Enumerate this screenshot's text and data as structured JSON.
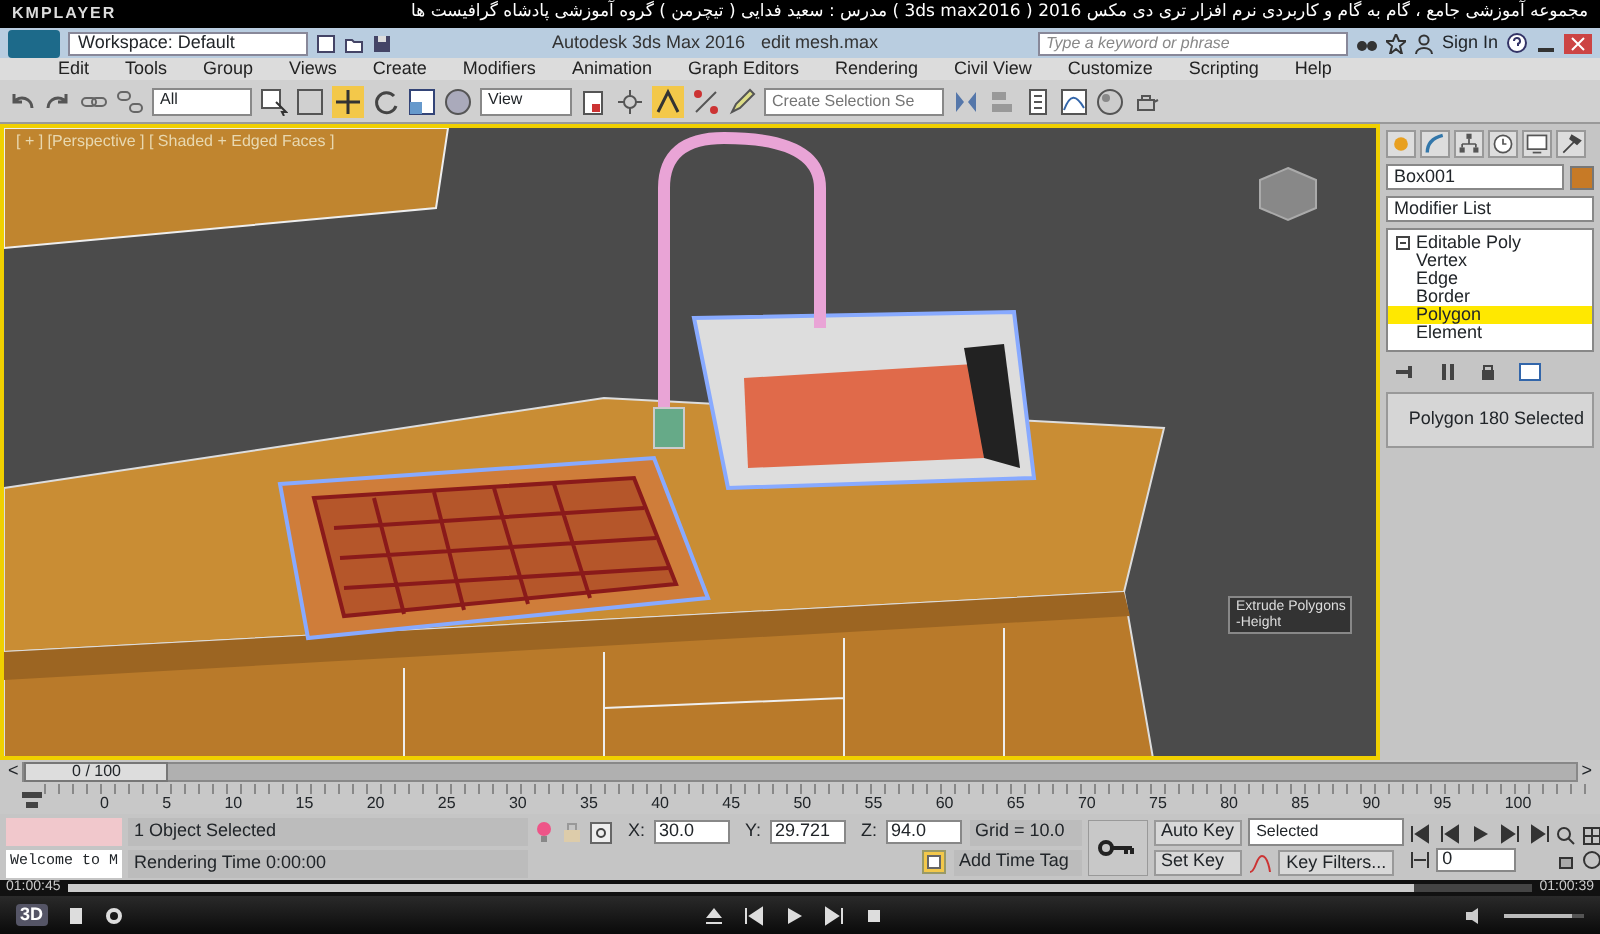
{
  "player": {
    "brand": "KMPLAYER",
    "title": "مجموعه آموزشی جامع ، گام به گام و کاربردی نرم افزار تری دی مکس 2016 ( 3ds max2016 ) مدرس : سعید فدایی ( تیچرمن ) گروه آموزشی پادشاه گرافیست ها"
  },
  "app": {
    "workspace": "Workspace: Default",
    "title": "Autodesk 3ds Max 2016",
    "file": "edit mesh.max",
    "search": {
      "placeholder": "Type a keyword or phrase"
    },
    "sign_in": "Sign In"
  },
  "menu": [
    "Edit",
    "Tools",
    "Group",
    "Views",
    "Create",
    "Modifiers",
    "Animation",
    "Graph Editors",
    "Rendering",
    "Civil View",
    "Customize",
    "Scripting",
    "Help"
  ],
  "toolbar": {
    "selection_filter": "All",
    "reference_coord": "View",
    "named_selection": {
      "placeholder": "Create Selection Se"
    }
  },
  "viewport": {
    "label": "[ + ] [Perspective ] [ Shaded + Edged Faces ]",
    "caddy": {
      "title": "Extrude Polygons",
      "field": "-Height"
    }
  },
  "command_panel": {
    "object_name": "Box001",
    "modifier_list": "Modifier List",
    "stack": [
      {
        "label": "Editable Poly",
        "expanded": true,
        "children": [
          {
            "label": "Vertex",
            "selected": false
          },
          {
            "label": "Edge",
            "selected": false
          },
          {
            "label": "Border",
            "selected": false
          },
          {
            "label": "Polygon",
            "selected": true
          },
          {
            "label": "Element",
            "selected": false
          }
        ]
      }
    ],
    "selection_info": "Polygon 180 Selected"
  },
  "time_slider": {
    "prev": "<",
    "label": "0 / 100",
    "next": ">",
    "level": 0
  },
  "trackbar": {
    "ticks": [
      "0",
      "5",
      "10",
      "15",
      "20",
      "25",
      "30",
      "35",
      "40",
      "45",
      "50",
      "55",
      "60",
      "65",
      "70",
      "75",
      "80",
      "85",
      "90",
      "95",
      "100"
    ]
  },
  "status": {
    "listener": "Welcome to M",
    "prompt": "1 Object Selected",
    "render_time": "Rendering Time  0:00:00",
    "coords": [
      {
        "axis": "X:",
        "value": "30.0"
      },
      {
        "axis": "Y:",
        "value": "29.721"
      },
      {
        "axis": "Z:",
        "value": "94.0"
      }
    ],
    "grid": "Grid = 10.0",
    "time_tag": "Add Time Tag",
    "auto_key": "Auto Key",
    "set_key": "Set Key",
    "key_mode": "Selected",
    "key_filters": "Key Filters...",
    "frame": "0"
  },
  "seek": {
    "elapsed": "01:00:45",
    "total": "01:00:39",
    "level": 0.92
  },
  "controls": {
    "badge": "3D"
  },
  "volume": {
    "level": 0.85
  }
}
